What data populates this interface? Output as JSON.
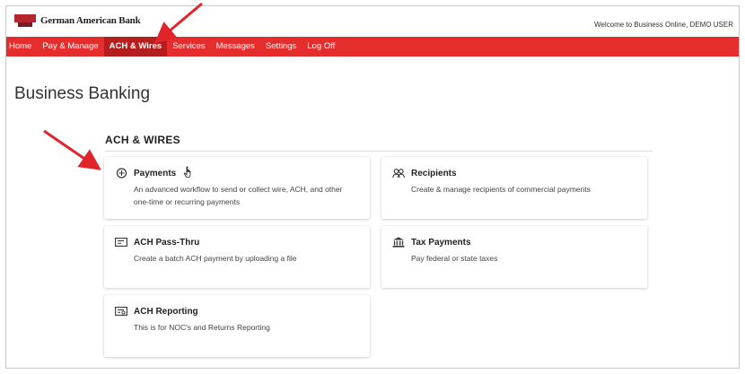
{
  "brand": {
    "name": "German American Bank",
    "logo_color": "#b3262e"
  },
  "header": {
    "welcome": "Welcome to Business Online, DEMO USER"
  },
  "nav": {
    "accent": "#e52d2d",
    "items": [
      {
        "label": "Home"
      },
      {
        "label": "Pay & Manage"
      },
      {
        "label": "ACH & Wires",
        "active": true
      },
      {
        "label": "Services"
      },
      {
        "label": "Messages"
      },
      {
        "label": "Settings"
      },
      {
        "label": "Log Off"
      }
    ]
  },
  "page": {
    "title": "Business Banking"
  },
  "section": {
    "title": "ACH & WIRES"
  },
  "cards": [
    {
      "title": "Payments",
      "desc": "An advanced workflow to send or collect wire, ACH, and other one-time or recurring payments",
      "icon": "payments-icon"
    },
    {
      "title": "Recipients",
      "desc": "Create & manage recipients of commercial payments",
      "icon": "recipients-icon"
    },
    {
      "title": "ACH Pass-Thru",
      "desc": "Create a batch ACH payment by uploading a file",
      "icon": "ach-pass-thru-icon"
    },
    {
      "title": "Tax Payments",
      "desc": "Pay federal or state taxes",
      "icon": "tax-building-icon"
    },
    {
      "title": "ACH Reporting",
      "desc": "This is for NOC's and Returns Reporting",
      "icon": "ach-reporting-icon"
    }
  ],
  "annotations": {
    "arrow_color": "#e0242a"
  }
}
